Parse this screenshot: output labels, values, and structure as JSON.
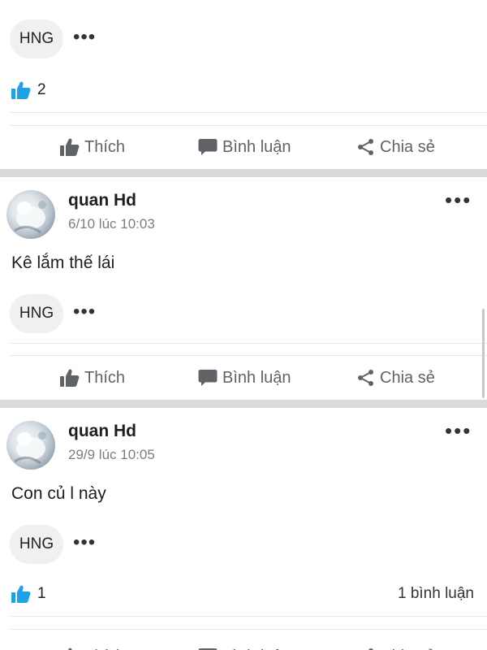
{
  "tag_label": "HNG",
  "more_glyph": "•••",
  "actions": {
    "like": "Thích",
    "comment": "Bình luận",
    "share": "Chia sẻ"
  },
  "colors": {
    "like_blue": "#1da1e8",
    "action_grey": "#5f6368",
    "separator": "#d9dadb"
  },
  "icons": [
    "thumbs-up-icon",
    "comment-bubble-icon",
    "share-icon",
    "more-dots-icon"
  ],
  "post0": {
    "likes": "2"
  },
  "post1": {
    "author": "quan Hd",
    "time": "6/10 lúc 10:03",
    "text": "Kê lắm thế lái"
  },
  "post2": {
    "author": "quan Hd",
    "time": "29/9 lúc 10:05",
    "text": "Con củ l này",
    "likes": "1",
    "comments": "1 bình luận"
  }
}
